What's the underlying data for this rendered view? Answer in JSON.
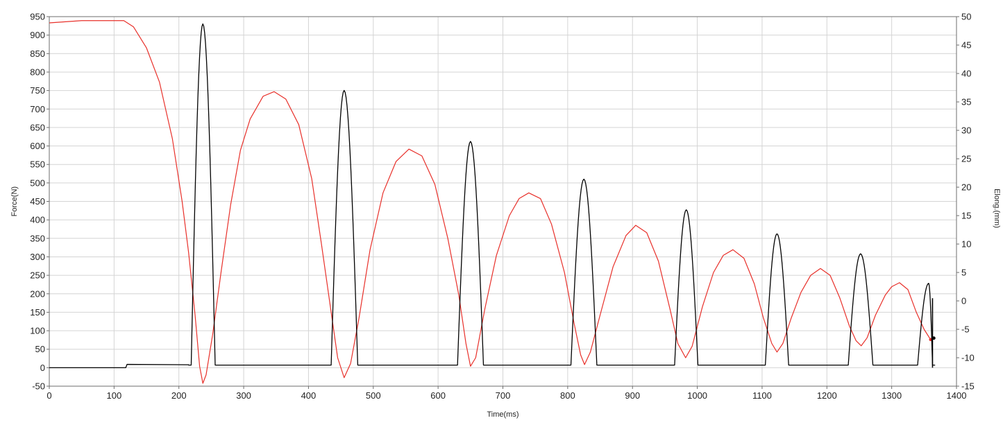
{
  "chart_data": {
    "type": "line",
    "xlabel": "Time(ms)",
    "ylabel_left": "Force(N)",
    "ylabel_right": "Elong.(mm)",
    "xlim": [
      0,
      1400
    ],
    "ylim_left": [
      -50,
      950
    ],
    "ylim_right": [
      -15,
      50
    ],
    "x_ticks": [
      "0",
      "100",
      "200",
      "300",
      "400",
      "500",
      "600",
      "700",
      "800",
      "900",
      "1000",
      "1100",
      "1200",
      "1300",
      "1400"
    ],
    "y_left_ticks": [
      "950",
      "900",
      "850",
      "800",
      "750",
      "700",
      "650",
      "600",
      "550",
      "500",
      "450",
      "400",
      "350",
      "300",
      "250",
      "200",
      "150",
      "100",
      "50",
      "0",
      "-50"
    ],
    "y_right_ticks": [
      "50",
      "45",
      "40",
      "35",
      "30",
      "25",
      "20",
      "15",
      "10",
      "5",
      "0",
      "-5",
      "-10",
      "-15"
    ],
    "grid": true,
    "series": [
      {
        "axis": "left",
        "color": "#000000",
        "baseline": [
          [
            0,
            0
          ],
          [
            118,
            0
          ],
          [
            120,
            9
          ],
          [
            215,
            8
          ]
        ],
        "pulses": [
          {
            "start": 219,
            "peak_t": 237,
            "end": 256,
            "peak": 930,
            "base": 7
          },
          {
            "start": 435,
            "peak_t": 455,
            "end": 476,
            "peak": 750,
            "base": 7
          },
          {
            "start": 630,
            "peak_t": 650,
            "end": 670,
            "peak": 612,
            "base": 7
          },
          {
            "start": 805,
            "peak_t": 825,
            "end": 845,
            "peak": 510,
            "base": 7
          },
          {
            "start": 965,
            "peak_t": 983,
            "end": 1001,
            "peak": 427,
            "base": 7
          },
          {
            "start": 1105,
            "peak_t": 1123,
            "end": 1141,
            "peak": 362,
            "base": 7
          },
          {
            "start": 1233,
            "peak_t": 1252,
            "end": 1271,
            "peak": 308,
            "base": 7
          },
          {
            "start": 1340,
            "peak_t": 1357,
            "end": 1363,
            "peak": 228,
            "base": 7
          }
        ]
      },
      {
        "axis": "right",
        "color": "#e8302a",
        "points": [
          [
            0,
            48.9
          ],
          [
            50,
            49.3
          ],
          [
            100,
            49.3
          ],
          [
            115,
            49.3
          ],
          [
            130,
            48.2
          ],
          [
            150,
            44.5
          ],
          [
            170,
            38.5
          ],
          [
            190,
            28.5
          ],
          [
            205,
            17.5
          ],
          [
            215,
            8.5
          ],
          [
            225,
            -2.5
          ],
          [
            232,
            -11.5
          ],
          [
            237,
            -14.5
          ],
          [
            242,
            -13.0
          ],
          [
            252,
            -6.0
          ],
          [
            265,
            5.0
          ],
          [
            280,
            17.0
          ],
          [
            295,
            26.5
          ],
          [
            310,
            32.0
          ],
          [
            330,
            36.0
          ],
          [
            347,
            36.8
          ],
          [
            365,
            35.5
          ],
          [
            385,
            31.0
          ],
          [
            405,
            21.5
          ],
          [
            420,
            10.0
          ],
          [
            435,
            -2.0
          ],
          [
            445,
            -10.0
          ],
          [
            455,
            -13.5
          ],
          [
            465,
            -11.0
          ],
          [
            478,
            -3.0
          ],
          [
            495,
            9.0
          ],
          [
            515,
            19.0
          ],
          [
            535,
            24.5
          ],
          [
            555,
            26.7
          ],
          [
            575,
            25.5
          ],
          [
            595,
            20.5
          ],
          [
            615,
            11.0
          ],
          [
            632,
            1.0
          ],
          [
            643,
            -7.5
          ],
          [
            650,
            -11.5
          ],
          [
            658,
            -10.0
          ],
          [
            672,
            -1.5
          ],
          [
            690,
            8.0
          ],
          [
            710,
            15.0
          ],
          [
            725,
            18.0
          ],
          [
            740,
            19.0
          ],
          [
            758,
            18.0
          ],
          [
            775,
            13.5
          ],
          [
            795,
            5.0
          ],
          [
            810,
            -4.0
          ],
          [
            820,
            -9.5
          ],
          [
            826,
            -11.2
          ],
          [
            835,
            -9.0
          ],
          [
            850,
            -2.5
          ],
          [
            870,
            6.0
          ],
          [
            890,
            11.5
          ],
          [
            905,
            13.3
          ],
          [
            922,
            12.0
          ],
          [
            940,
            7.0
          ],
          [
            958,
            -1.5
          ],
          [
            970,
            -7.5
          ],
          [
            982,
            -10.0
          ],
          [
            992,
            -8.0
          ],
          [
            1008,
            -1.0
          ],
          [
            1025,
            5.0
          ],
          [
            1040,
            8.0
          ],
          [
            1055,
            9.0
          ],
          [
            1072,
            7.5
          ],
          [
            1088,
            3.0
          ],
          [
            1102,
            -3.0
          ],
          [
            1115,
            -7.5
          ],
          [
            1123,
            -9.0
          ],
          [
            1132,
            -7.5
          ],
          [
            1145,
            -3.0
          ],
          [
            1160,
            1.5
          ],
          [
            1175,
            4.5
          ],
          [
            1190,
            5.7
          ],
          [
            1205,
            4.5
          ],
          [
            1220,
            0.5
          ],
          [
            1235,
            -4.5
          ],
          [
            1245,
            -7.0
          ],
          [
            1253,
            -7.9
          ],
          [
            1262,
            -6.5
          ],
          [
            1275,
            -2.5
          ],
          [
            1290,
            1.0
          ],
          [
            1300,
            2.5
          ],
          [
            1312,
            3.2
          ],
          [
            1325,
            2.0
          ],
          [
            1338,
            -2.0
          ],
          [
            1350,
            -5.0
          ],
          [
            1360,
            -6.8
          ]
        ]
      }
    ]
  }
}
